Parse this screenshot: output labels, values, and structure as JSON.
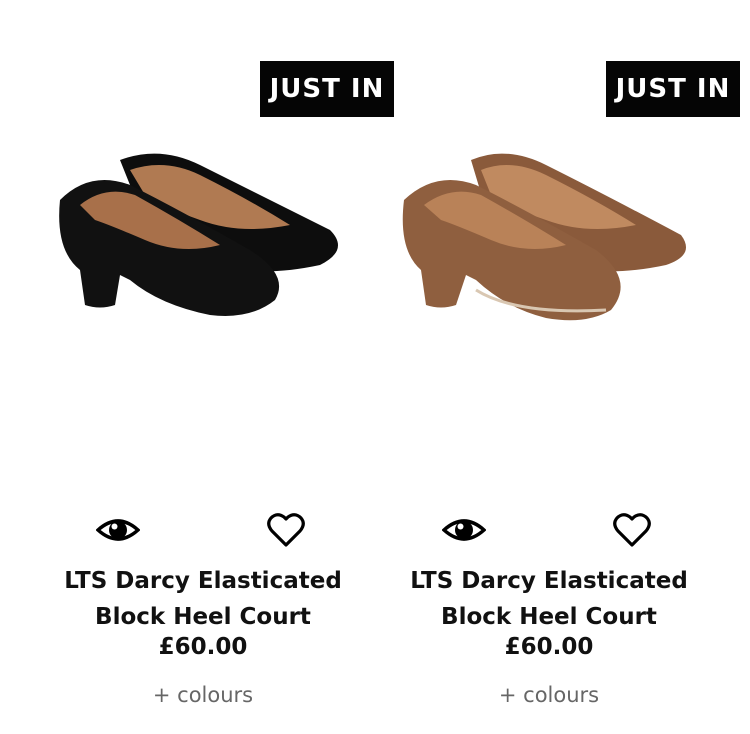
{
  "products": [
    {
      "badge": "JUST IN",
      "title": "LTS Darcy Elasticated Block Heel Court",
      "price": "£60.00",
      "colours_link": "+ colours",
      "shoe_color": "#0d0d0d",
      "lining_color": "#b07a52"
    },
    {
      "badge": "JUST IN",
      "title": "LTS Darcy Elasticated Block Heel Court",
      "price": "£60.00",
      "colours_link": "+ colours",
      "shoe_color": "#8a5a3b",
      "lining_color": "#c08a60"
    }
  ],
  "icons": {
    "quick_view": "eye-icon",
    "wishlist": "heart-icon"
  }
}
